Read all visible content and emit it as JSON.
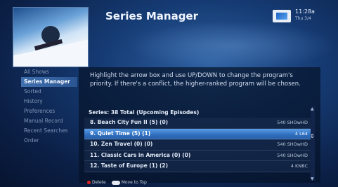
{
  "header": {
    "title": "Series Manager",
    "clock_time": "11:28a",
    "clock_date": "Thu 3/4"
  },
  "sidebar": {
    "items": [
      {
        "label": "All Shows"
      },
      {
        "label": "Series Manager"
      },
      {
        "label": "Sorted"
      },
      {
        "label": "History"
      },
      {
        "label": "Preferences"
      },
      {
        "label": "Manual Record"
      },
      {
        "label": "Recent Searches"
      },
      {
        "label": "Order"
      }
    ]
  },
  "main": {
    "instructions": "Highlight the arrow box and use UP/DOWN to change the program's priority. If there's a conflict, the higher-ranked program will be chosen.",
    "series_header": "Series: 38 Total (Upcoming Episodes)",
    "rows": [
      {
        "label": "8.   Beach City Fun II (5) (0)",
        "channel": "540 SHOwHD"
      },
      {
        "label": "9.   Quiet Time (5) (1)",
        "channel": "4 L64"
      },
      {
        "label": "10.  Zen Travel (0) (0)",
        "channel": "540 SHOwHD"
      },
      {
        "label": "11.  Classic Cars in America (0) (0)",
        "channel": "540 SHOwHD"
      },
      {
        "label": "12.  Taste of Europe (1) (2)",
        "channel": "4 KNBC"
      }
    ]
  },
  "footer": {
    "delete_label": "Delete",
    "move_label": "Move to Top"
  }
}
